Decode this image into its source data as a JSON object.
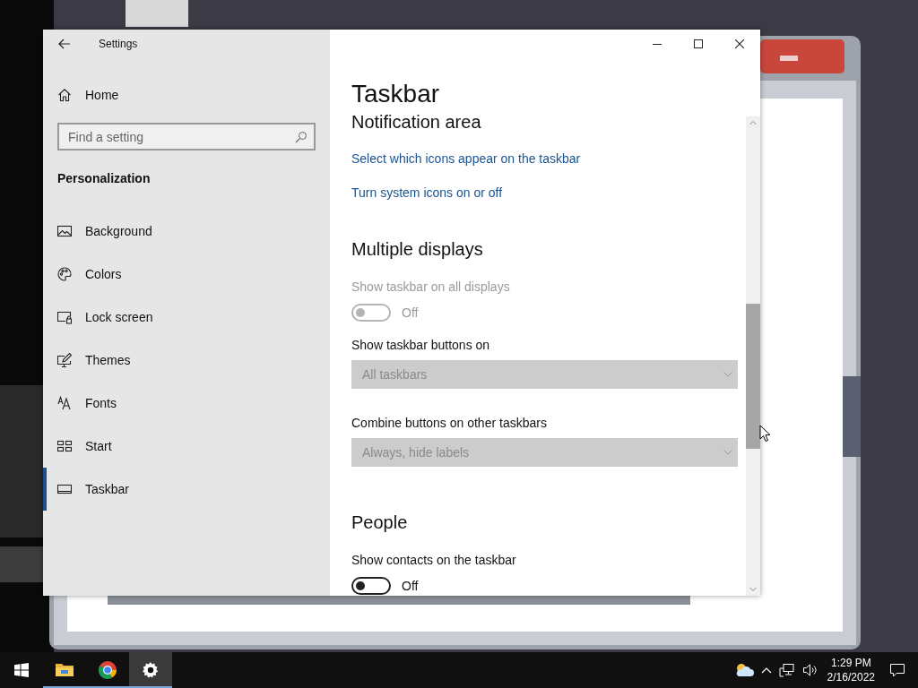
{
  "window": {
    "title": "Settings"
  },
  "sidebar": {
    "home": "Home",
    "search": {
      "placeholder": "Find a setting"
    },
    "section": "Personalization",
    "items": [
      {
        "label": "Background",
        "kind": "background",
        "selected": false
      },
      {
        "label": "Colors",
        "kind": "colors",
        "selected": false
      },
      {
        "label": "Lock screen",
        "kind": "lock",
        "selected": false
      },
      {
        "label": "Themes",
        "kind": "themes",
        "selected": false
      },
      {
        "label": "Fonts",
        "kind": "fonts",
        "selected": false
      },
      {
        "label": "Start",
        "kind": "start",
        "selected": false
      },
      {
        "label": "Taskbar",
        "kind": "taskbar",
        "selected": true
      }
    ]
  },
  "page": {
    "title": "Taskbar",
    "items": [
      {
        "kind": "heading",
        "text": "Notification area"
      },
      {
        "kind": "link",
        "text": "Select which icons appear on the taskbar"
      },
      {
        "kind": "link",
        "text": "Turn system icons on or off"
      },
      {
        "kind": "heading",
        "text": "Multiple displays"
      },
      {
        "kind": "toggle",
        "label": "Show taskbar on all displays",
        "on": false,
        "disabled": true,
        "state_text": "Off"
      },
      {
        "kind": "dropdown",
        "label": "Show taskbar buttons on",
        "value": "All taskbars",
        "disabled": true
      },
      {
        "kind": "dropdown",
        "label": "Combine buttons on other taskbars",
        "value": "Always, hide labels",
        "disabled": true
      },
      {
        "kind": "heading",
        "text": "People"
      },
      {
        "kind": "toggle",
        "label": "Show contacts on the taskbar",
        "on": false,
        "disabled": false,
        "state_text": "Off"
      }
    ]
  },
  "taskbar": {
    "apps": [
      {
        "kind": "start",
        "running": false,
        "selected": false
      },
      {
        "kind": "explorer",
        "running": true,
        "selected": false
      },
      {
        "kind": "browser",
        "running": true,
        "selected": false
      },
      {
        "kind": "settings",
        "running": true,
        "selected": true
      }
    ],
    "time": "1:29 PM",
    "date": "2/16/2022"
  }
}
